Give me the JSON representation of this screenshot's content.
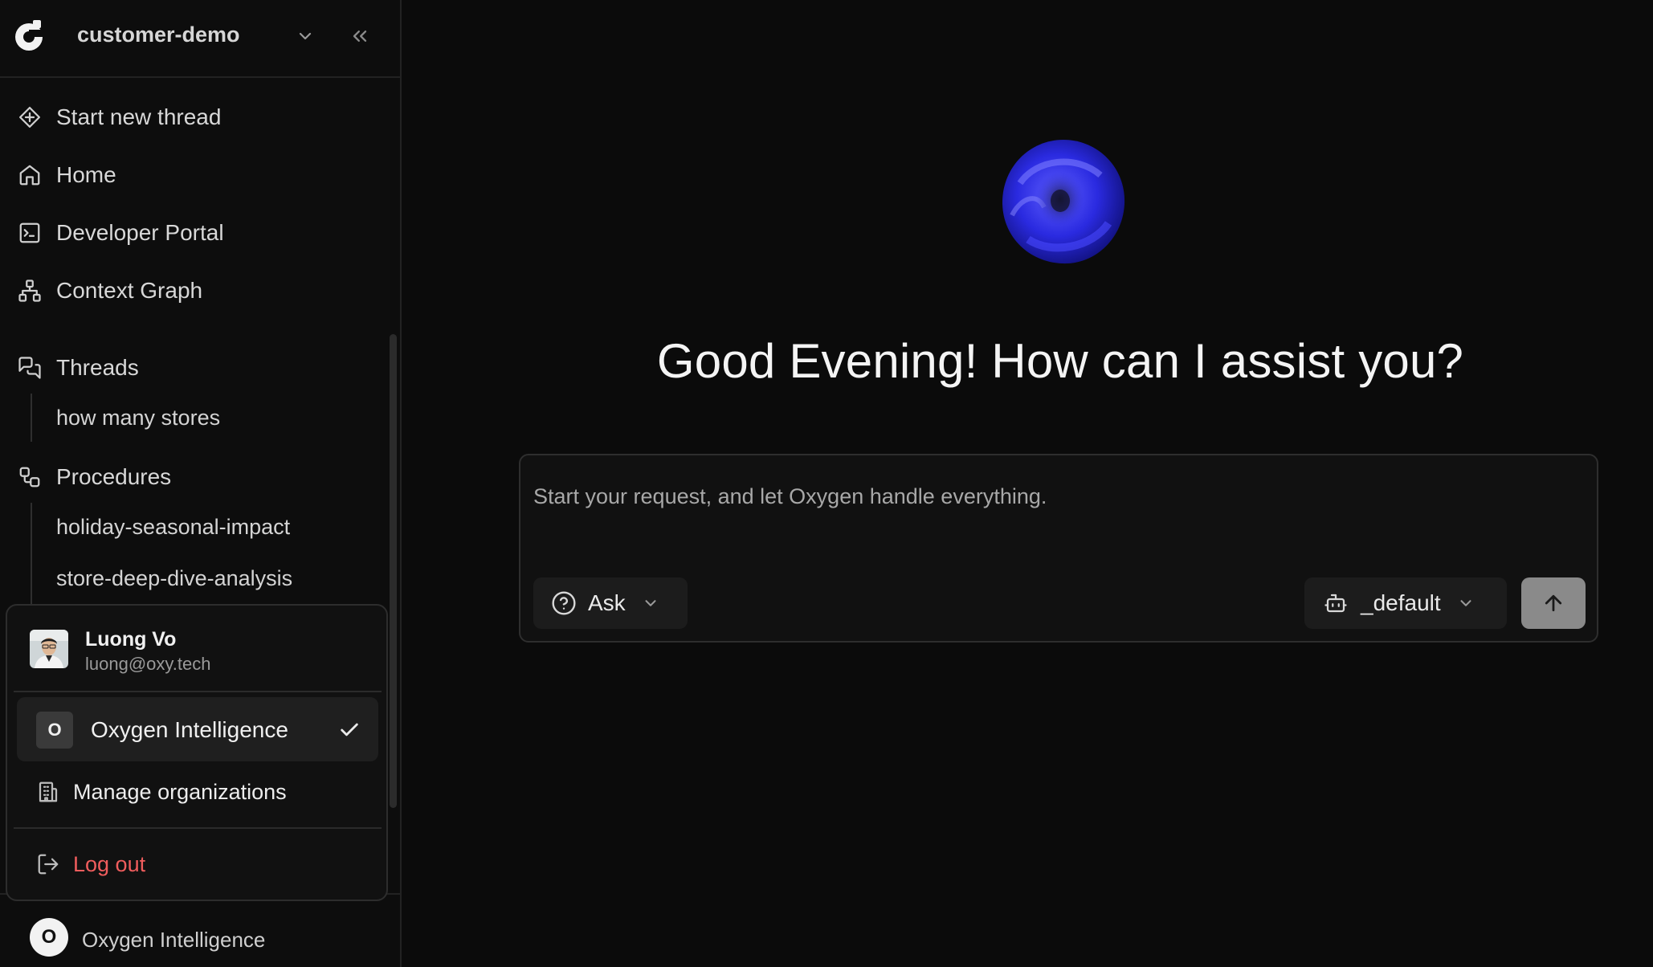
{
  "workspace": {
    "name": "customer-demo"
  },
  "nav": {
    "start_thread": "Start new thread",
    "home": "Home",
    "developer_portal": "Developer Portal",
    "context_graph": "Context Graph"
  },
  "threads": {
    "label": "Threads",
    "items": [
      "how many stores"
    ]
  },
  "procedures": {
    "label": "Procedures",
    "items": [
      "holiday-seasonal-impact",
      "store-deep-dive-analysis"
    ]
  },
  "user_menu": {
    "name": "Luong Vo",
    "email": "luong@oxy.tech",
    "org_initial": "O",
    "current_org": "Oxygen Intelligence",
    "manage_orgs": "Manage organizations",
    "logout": "Log out"
  },
  "footer": {
    "org_initial": "O",
    "org_name": "Oxygen Intelligence"
  },
  "main": {
    "greeting": "Good Evening! How can I assist you?",
    "input_placeholder": "Start your request, and let Oxygen handle everything.",
    "mode_label": "Ask",
    "agent_label": "_default"
  },
  "colors": {
    "logout": "#f05d5d",
    "orb": "#2a2ae0",
    "send_disabled": "#8a8a8a"
  }
}
